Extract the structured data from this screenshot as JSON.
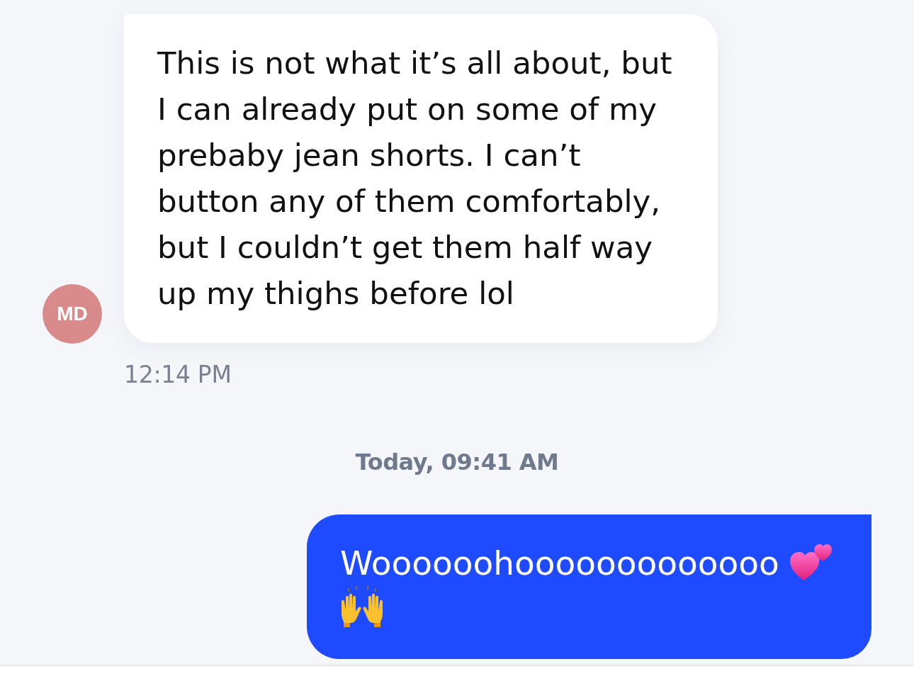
{
  "messages": [
    {
      "kind": "received",
      "avatar": "MD",
      "text": "This is not what it’s all about, but I can already put on some of my prebaby jean shorts. I can’t button any of them comfortably, but I couldn’t get them half way up my thighs before lol",
      "time": "12:14 PM"
    },
    {
      "kind": "divider",
      "text": "Today, 09:41 AM"
    },
    {
      "kind": "sent",
      "content": [
        {
          "kind": "text",
          "text": "Woooooohooooooooooooo"
        },
        {
          "kind": "hearts"
        },
        {
          "kind": "hands"
        }
      ]
    }
  ]
}
